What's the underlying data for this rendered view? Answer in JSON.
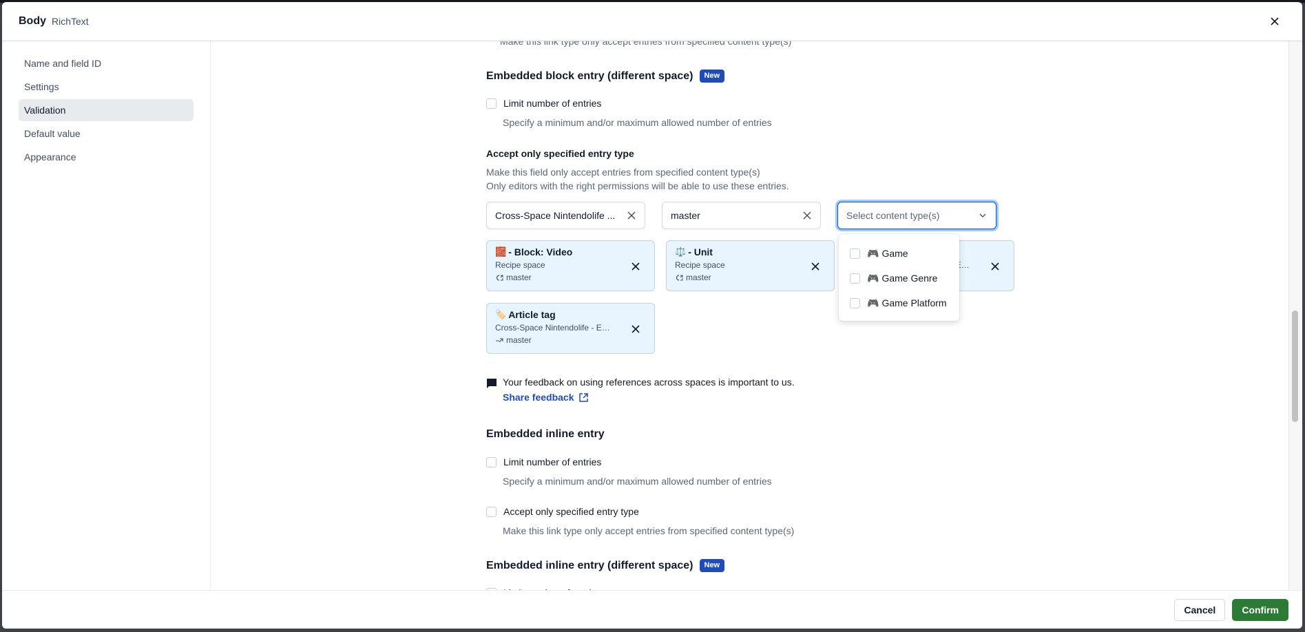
{
  "modal": {
    "title": "Body",
    "subtitle": "RichText",
    "close_label": "Close"
  },
  "sidebar": {
    "items": [
      {
        "label": "Name and field ID",
        "active": false
      },
      {
        "label": "Settings",
        "active": false
      },
      {
        "label": "Validation",
        "active": true
      },
      {
        "label": "Default value",
        "active": false
      },
      {
        "label": "Appearance",
        "active": false
      }
    ]
  },
  "content": {
    "top_cut_desc": "Make this link type only accept entries from specified content type(s)",
    "block_diff_space": {
      "title": "Embedded block entry (different space)",
      "badge": "New",
      "limit_label": "Limit number of entries",
      "limit_desc": "Specify a minimum and/or maximum allowed number of entries",
      "accept_label": "Accept only specified entry type",
      "accept_desc_1": "Make this field only accept entries from specified content type(s)",
      "accept_desc_2": "Only editors with the right permissions will be able to use these entries.",
      "space_select": {
        "value": "Cross-Space Nintendolife ..."
      },
      "env_select": {
        "value": "master"
      },
      "content_type_select": {
        "placeholder": "Select content type(s)"
      },
      "content_type_options": [
        {
          "emoji": "🎮",
          "label": "Game",
          "checked": false
        },
        {
          "emoji": "🎮",
          "label": "Game Genre",
          "checked": false
        },
        {
          "emoji": "🎮",
          "label": "Game Platform",
          "checked": false
        }
      ],
      "entries": [
        {
          "emoji": "🧱",
          "title": "- Block: Video",
          "space": "Recipe space",
          "env": "master",
          "env_icon": "environment-alias-icon"
        },
        {
          "emoji": "⚖️",
          "title": "- Unit",
          "space": "Recipe space",
          "env": "master",
          "env_icon": "environment-alias-icon"
        },
        {
          "emoji": "",
          "title": "",
          "space": "Cross-Space Nintendolife - E…",
          "env": "",
          "env_icon": "environment-icon"
        },
        {
          "emoji": "🏷️",
          "title": "Article tag",
          "space": "Cross-Space Nintendolife - E…",
          "env": "master",
          "env_icon": "environment-icon"
        }
      ],
      "feedback_text": "Your feedback on using references across spaces is important to us.",
      "feedback_link": "Share feedback"
    },
    "inline": {
      "title": "Embedded inline entry",
      "limit_label": "Limit number of entries",
      "limit_desc": "Specify a minimum and/or maximum allowed number of entries",
      "accept_label": "Accept only specified entry type",
      "accept_desc": "Make this link type only accept entries from specified content type(s)"
    },
    "inline_diff_space": {
      "title": "Embedded inline entry (different space)",
      "badge": "New",
      "limit_label": "Limit number of entries"
    }
  },
  "footer": {
    "cancel_label": "Cancel",
    "confirm_label": "Confirm"
  },
  "colors": {
    "accent": "#1e4cbb",
    "positive": "#2b7a36",
    "card_bg": "#e8f5ff"
  }
}
